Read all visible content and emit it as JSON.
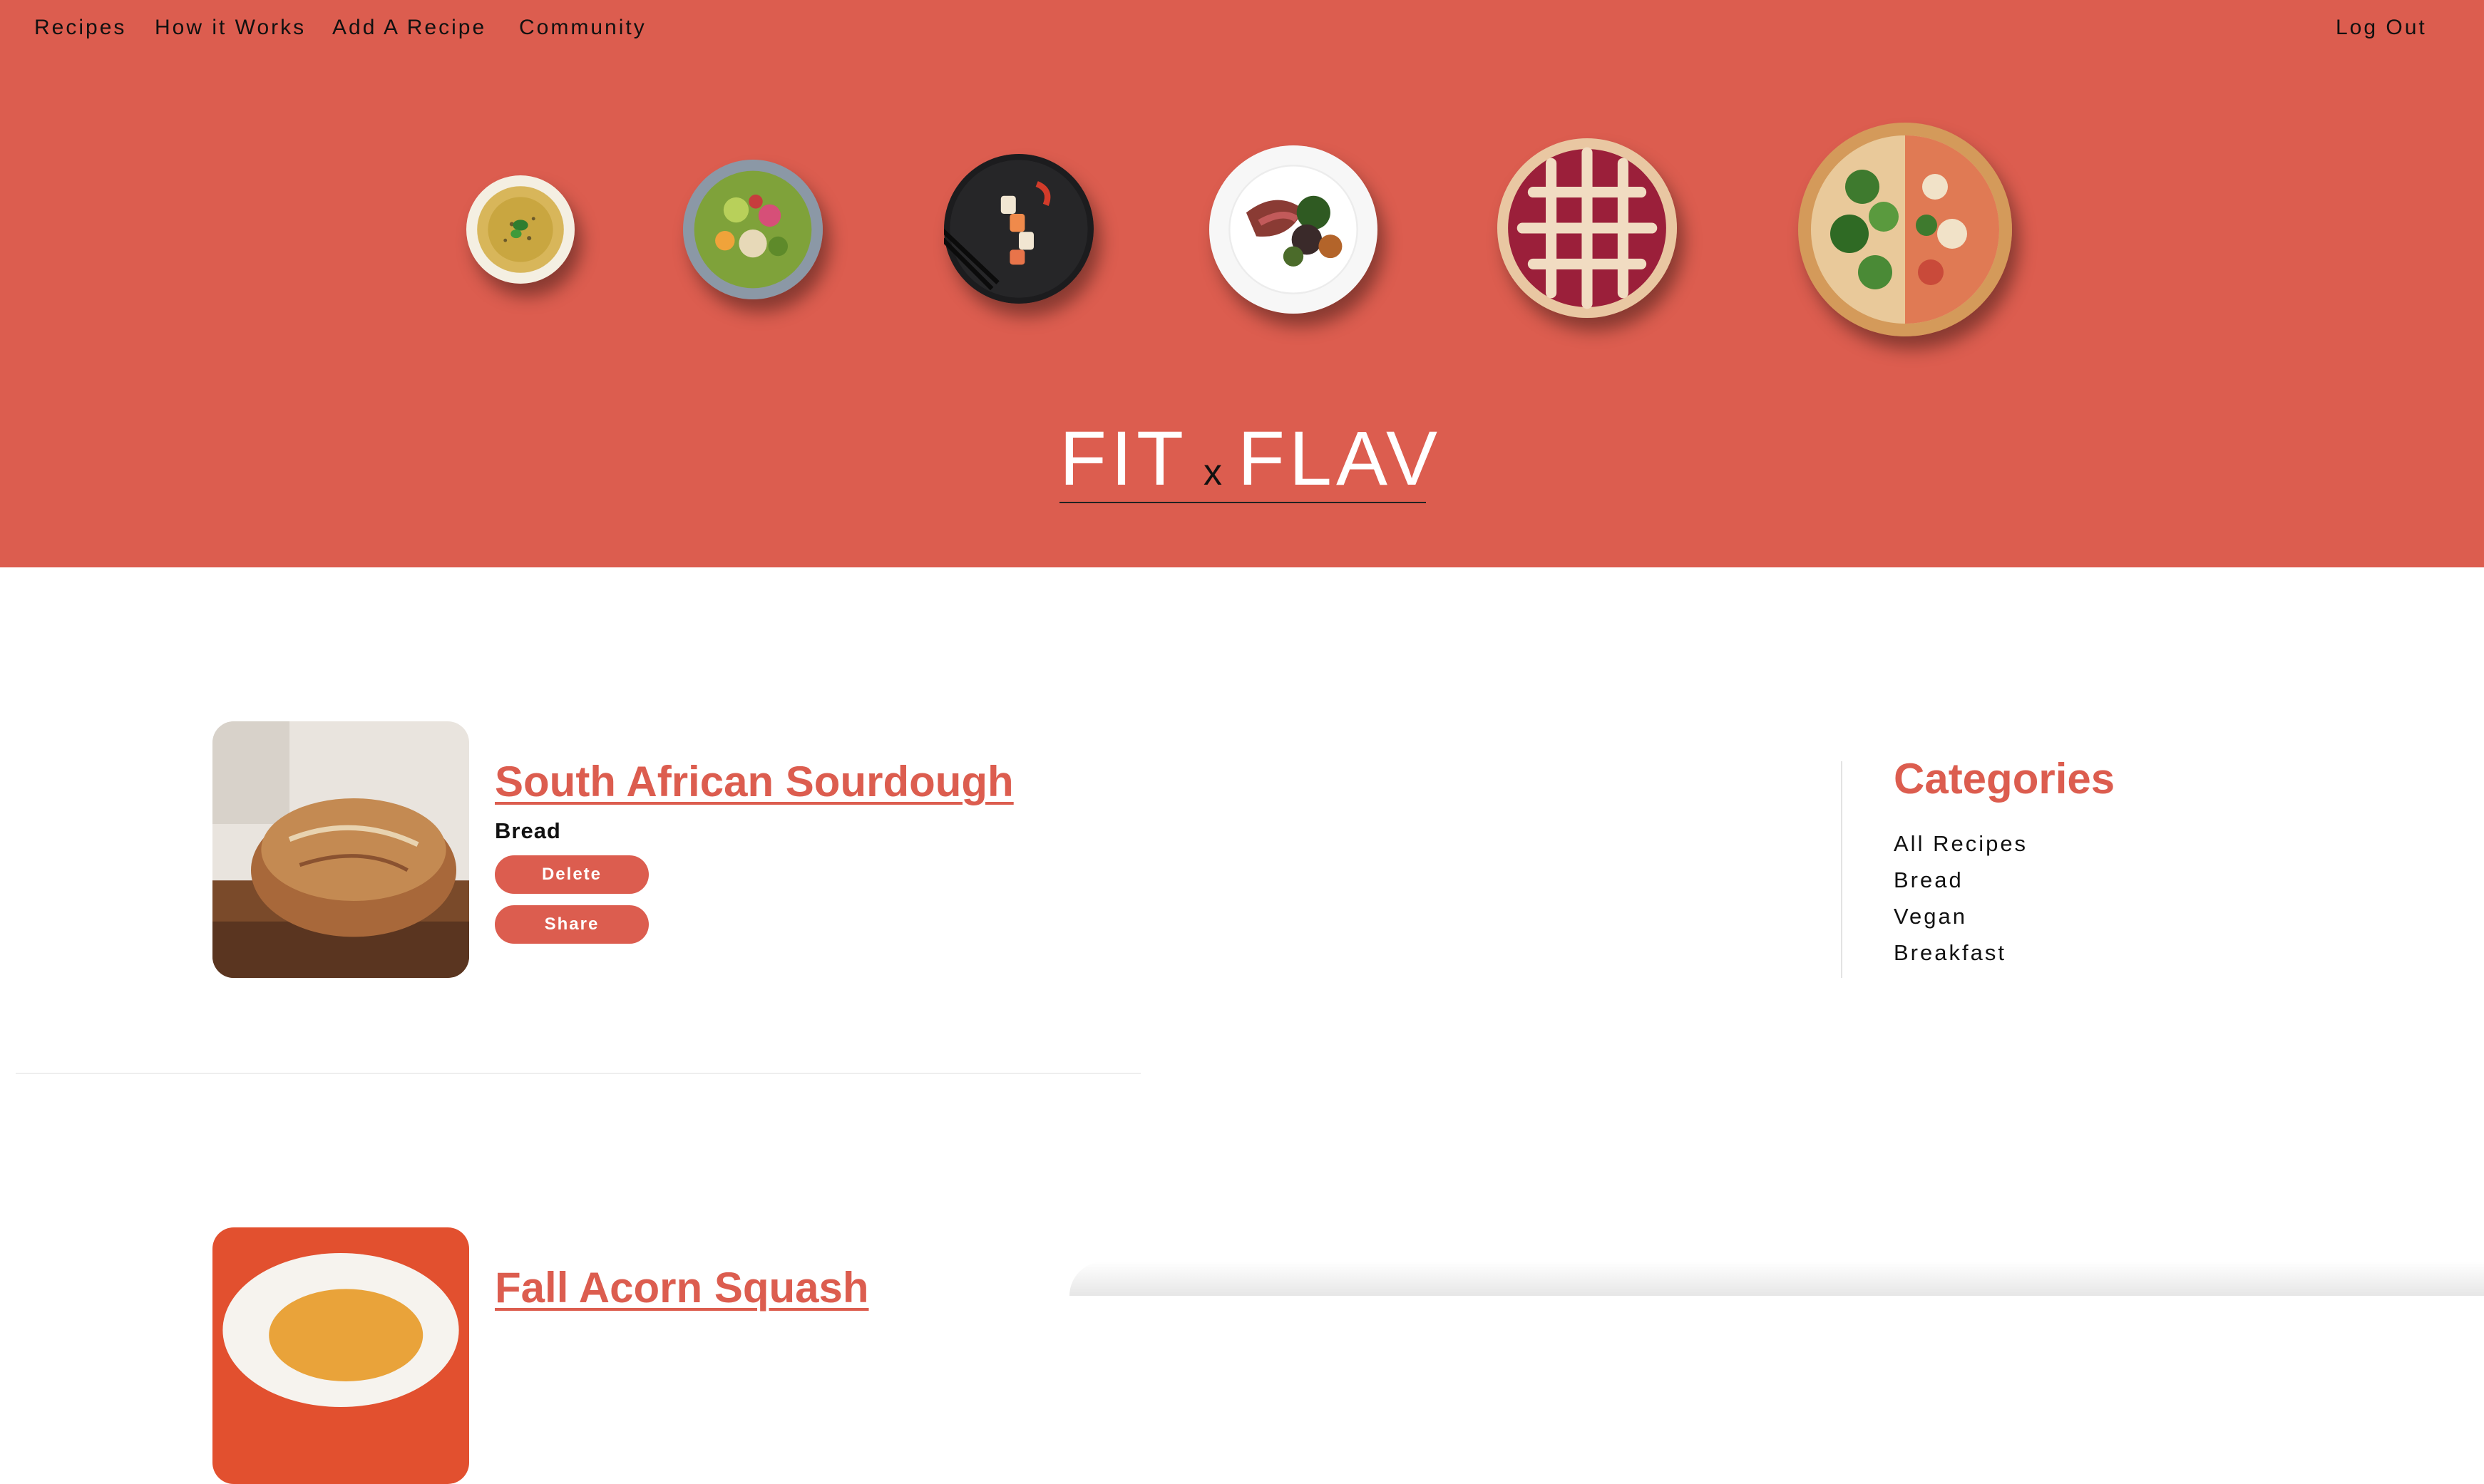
{
  "nav": {
    "links": [
      "Recipes",
      "How it Works",
      "Add A Recipe",
      "Community"
    ],
    "logout": "Log Out"
  },
  "brand": {
    "left": "FIT",
    "middle": "x",
    "right": "FLAV"
  },
  "recipes": [
    {
      "title": "South African Sourdough",
      "category": "Bread",
      "delete_label": "Delete",
      "share_label": "Share"
    },
    {
      "title": "Fall Acorn Squash"
    }
  ],
  "sidebar": {
    "title": "Categories",
    "items": [
      "All Recipes",
      "Bread",
      "Vegan",
      "Breakfast"
    ]
  },
  "colors": {
    "accent": "#dc5d4f",
    "hero_bg": "#dc5d4f"
  },
  "icons": [
    "hummus-bowl-image",
    "salad-bowl-image",
    "sushi-plate-image",
    "steak-plate-image",
    "berry-pie-image",
    "pizza-image"
  ]
}
